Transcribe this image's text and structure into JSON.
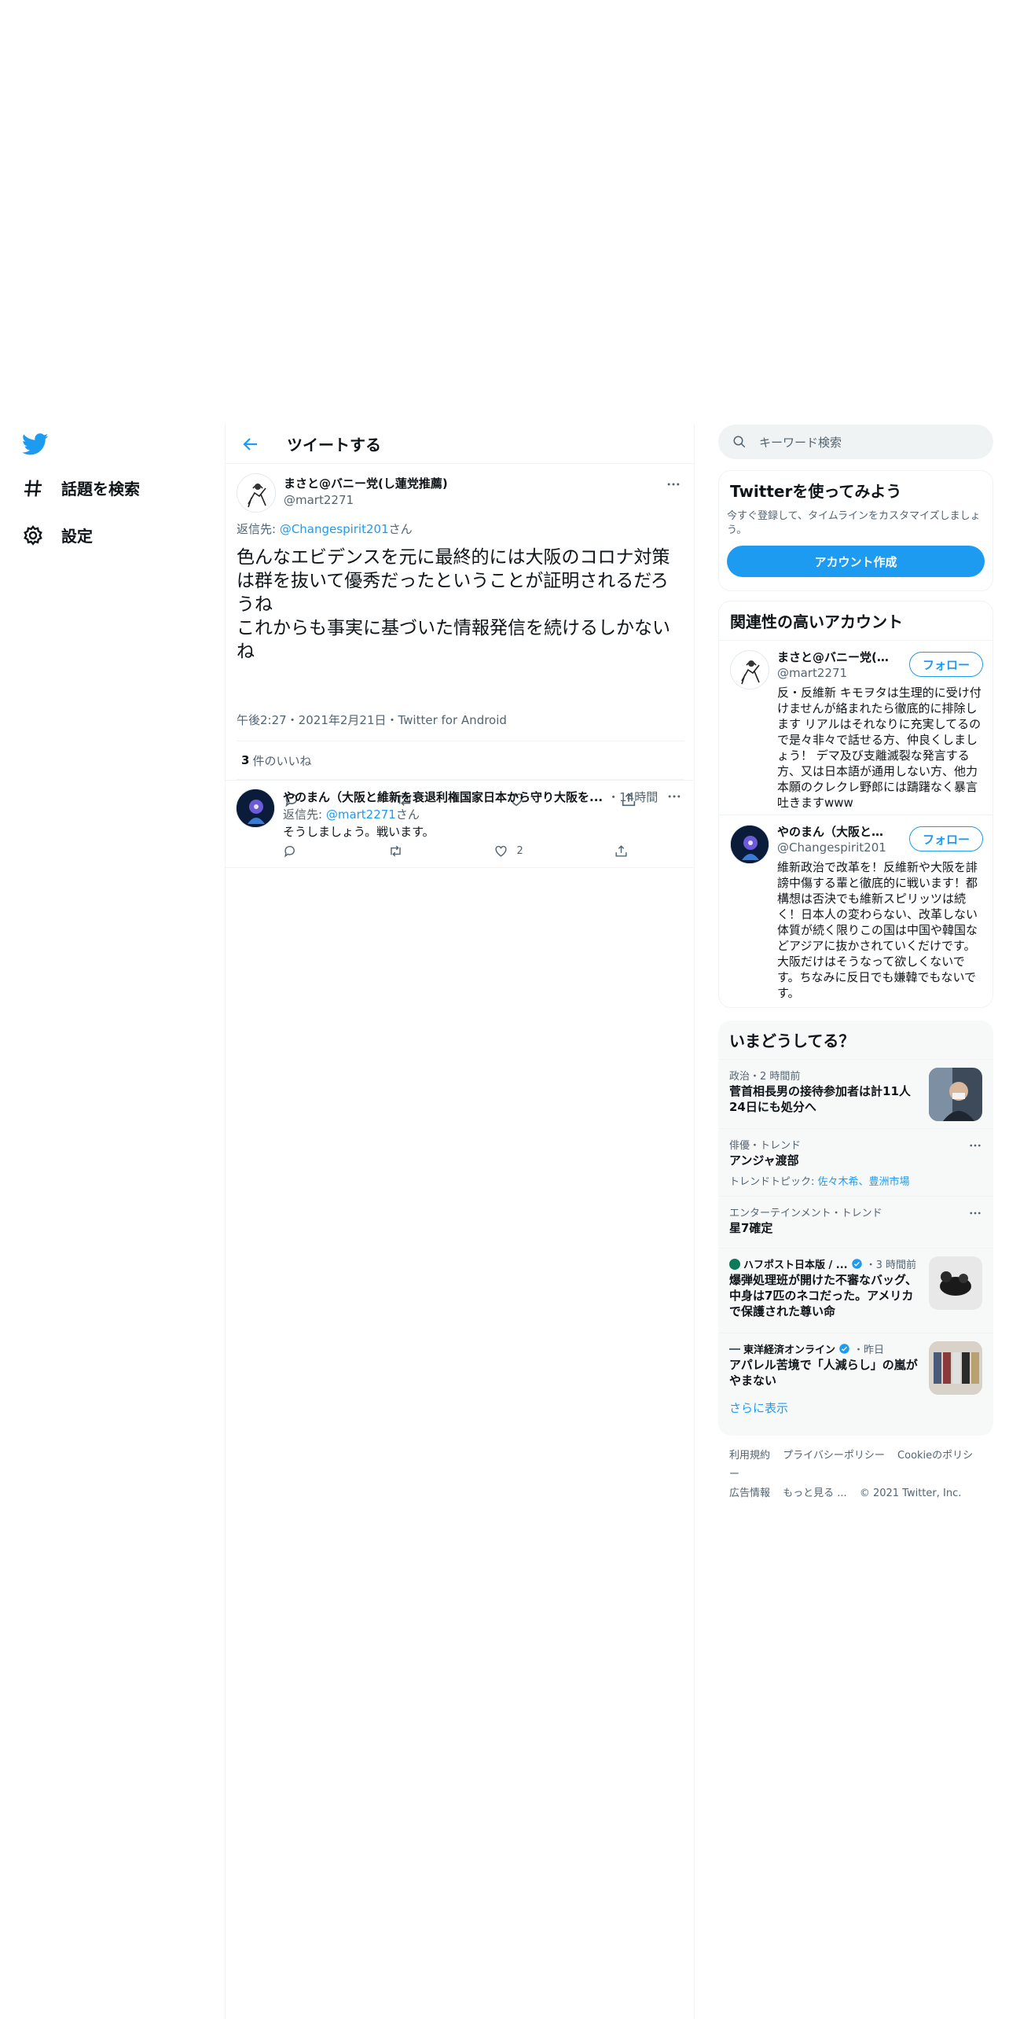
{
  "nav": {
    "items": [
      {
        "label": "話題を検索",
        "icon": "hashtag-icon"
      },
      {
        "label": "設定",
        "icon": "gear-icon"
      }
    ]
  },
  "header": {
    "title": "ツイートする"
  },
  "main_tweet": {
    "name": "まさと@バニー党(し蓮党推薦)",
    "handle": "@mart2271",
    "reply_prefix": "返信先: ",
    "reply_to": "@Changespirit201",
    "reply_suffix": "さん",
    "text": "色んなエビデンスを元に最終的には大阪のコロナ対策は群を抜いて優秀だったということが証明されるだろうね\nこれからも事実に基づいた情報発信を続けるしかないね",
    "meta": "午後2:27・2021年2月21日・Twitter for Android",
    "likes_count": "3",
    "likes_label": "件のいいね"
  },
  "reply": {
    "name": "やのまん（大阪と維新を衰退利権国家日本から守り大阪を...",
    "time": "・14時間",
    "reply_prefix": "返信先: ",
    "reply_to": "@mart2271",
    "reply_suffix": "さん",
    "text": "そうしましょう。戦います。",
    "like_count": "2"
  },
  "search": {
    "placeholder": "キーワード検索"
  },
  "cta": {
    "title": "Twitterを使ってみよう",
    "subtitle": "今すぐ登録して、タイムラインをカスタマイズしましょう。",
    "button": "アカウント作成"
  },
  "related": {
    "title": "関連性の高いアカウント",
    "follow_label": "フォロー",
    "accounts": [
      {
        "name": "まさと@バニー党(し...",
        "handle": "@mart2271",
        "bio": "反・反維新 キモヲタは生理的に受け付けませんが絡まれたら徹底的に排除します リアルはそれなりに充実してるので是々非々で話せる方、仲良くしましょう！ デマ及び支離滅裂な発言する方、又は日本語が通用しない方、他力本願のクレクレ野郎には躊躇なく暴言吐きますwww"
      },
      {
        "name": "やのまん（大阪と維...",
        "handle": "@Changespirit201",
        "bio": "維新政治で改革を！反維新や大阪を誹謗中傷する輩と徹底的に戦います！都構想は否決でも維新スピリッツは続く！日本人の変わらない、改革しない体質が続く限りこの国は中国や韓国などアジアに抜かされていくだけです。大阪だけはそうなって欲しくないです。ちなみに反日でも嫌韓でもないです。"
      }
    ]
  },
  "trends": {
    "title": "いまどうしてる？",
    "items": [
      {
        "category": "政治・2 時間前",
        "title": "菅首相長男の接待参加者は計11人 24日にも処分へ"
      },
      {
        "category": "俳優・トレンド",
        "title": "アンジャ渡部",
        "sub_prefix": "トレンドトピック: ",
        "sub_links": "佐々木希、豊洲市場"
      },
      {
        "category": "エンターテインメント・トレンド",
        "title": "星7確定"
      },
      {
        "source": "ハフポスト日本版 / ...",
        "time": "・3 時間前",
        "title": "爆弾処理班が開けた不審なバッグ、中身は7匹のネコだった。アメリカで保護された尊い命"
      },
      {
        "source": "東洋経済オンライン",
        "time": "・昨日",
        "title": "アパレル苦境で「人減らし」の嵐がやまない"
      }
    ],
    "show_more": "さらに表示"
  },
  "footer": {
    "links": [
      "利用規約",
      "プライバシーポリシー",
      "Cookieのポリシー",
      "広告情報",
      "もっと見る ..."
    ],
    "copyright": "© 2021 Twitter, Inc."
  },
  "colors": {
    "accent": "#1d9bf0",
    "text": "#0f1419",
    "muted": "#536471",
    "border": "#eff3f4"
  }
}
